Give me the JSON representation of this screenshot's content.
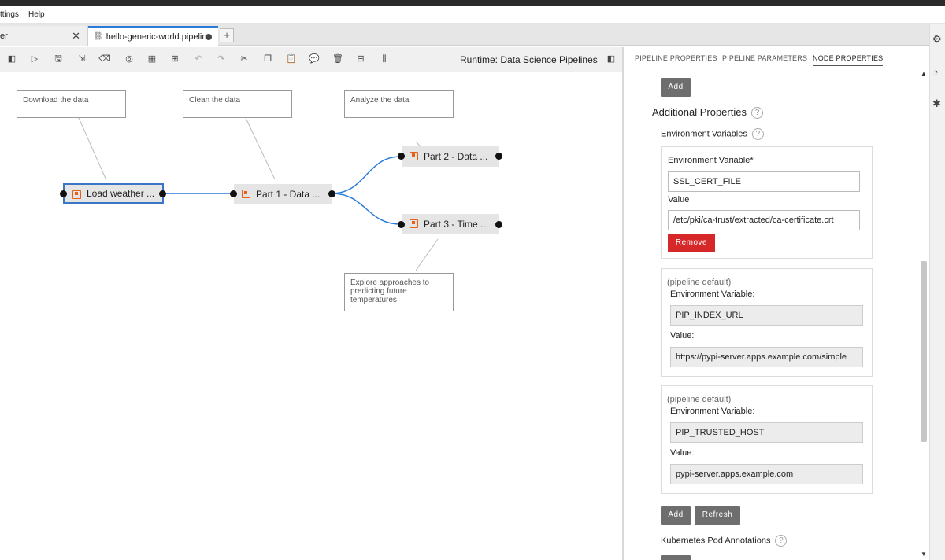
{
  "menu": {
    "settings": "ttings",
    "help": "Help"
  },
  "tabs": [
    {
      "label": "er"
    },
    {
      "label": "hello-generic-world.pipeline"
    }
  ],
  "toolbar": {
    "runtime": "Runtime: Data Science Pipelines"
  },
  "canvas": {
    "comments": {
      "download": "Download the data",
      "clean": "Clean the data",
      "analyze": "Analyze the data",
      "explore": "Explore approaches to predicting future temperatures"
    },
    "nodes": {
      "load": "Load weather ...",
      "part1": "Part 1 - Data ...",
      "part2": "Part 2 - Data ...",
      "part3": "Part 3 - Time ..."
    },
    "link_color": "#2a7bd7"
  },
  "panel": {
    "tabs": {
      "pipeline_properties": "PIPELINE PROPERTIES",
      "pipeline_parameters": "PIPELINE PARAMETERS",
      "node_properties": "NODE PROPERTIES"
    },
    "add_top": "Add",
    "additional_properties": "Additional Properties",
    "env_vars_heading": "Environment Variables",
    "help_glyph": "?",
    "card1": {
      "env_label": "Environment Variable*",
      "env_value": "SSL_CERT_FILE",
      "value_label": "Value",
      "value": "/etc/pki/ca-trust/extracted/ca-certificate.crt",
      "remove": "Remove"
    },
    "card2": {
      "default_label": "(pipeline default)",
      "env_label": "Environment Variable:",
      "env_value": "PIP_INDEX_URL",
      "value_label": "Value:",
      "value": "https://pypi-server.apps.example.com/simple"
    },
    "card3": {
      "default_label": "(pipeline default)",
      "env_label": "Environment Variable:",
      "env_value": "PIP_TRUSTED_HOST",
      "value_label": "Value:",
      "value": "pypi-server.apps.example.com"
    },
    "add_bottom": "Add",
    "refresh": "Refresh",
    "k8s_annotations": "Kubernetes Pod Annotations"
  },
  "colors": {
    "remove_button": "#d62828",
    "selection": "#3a76c4",
    "node_icon": "#e8611a"
  }
}
